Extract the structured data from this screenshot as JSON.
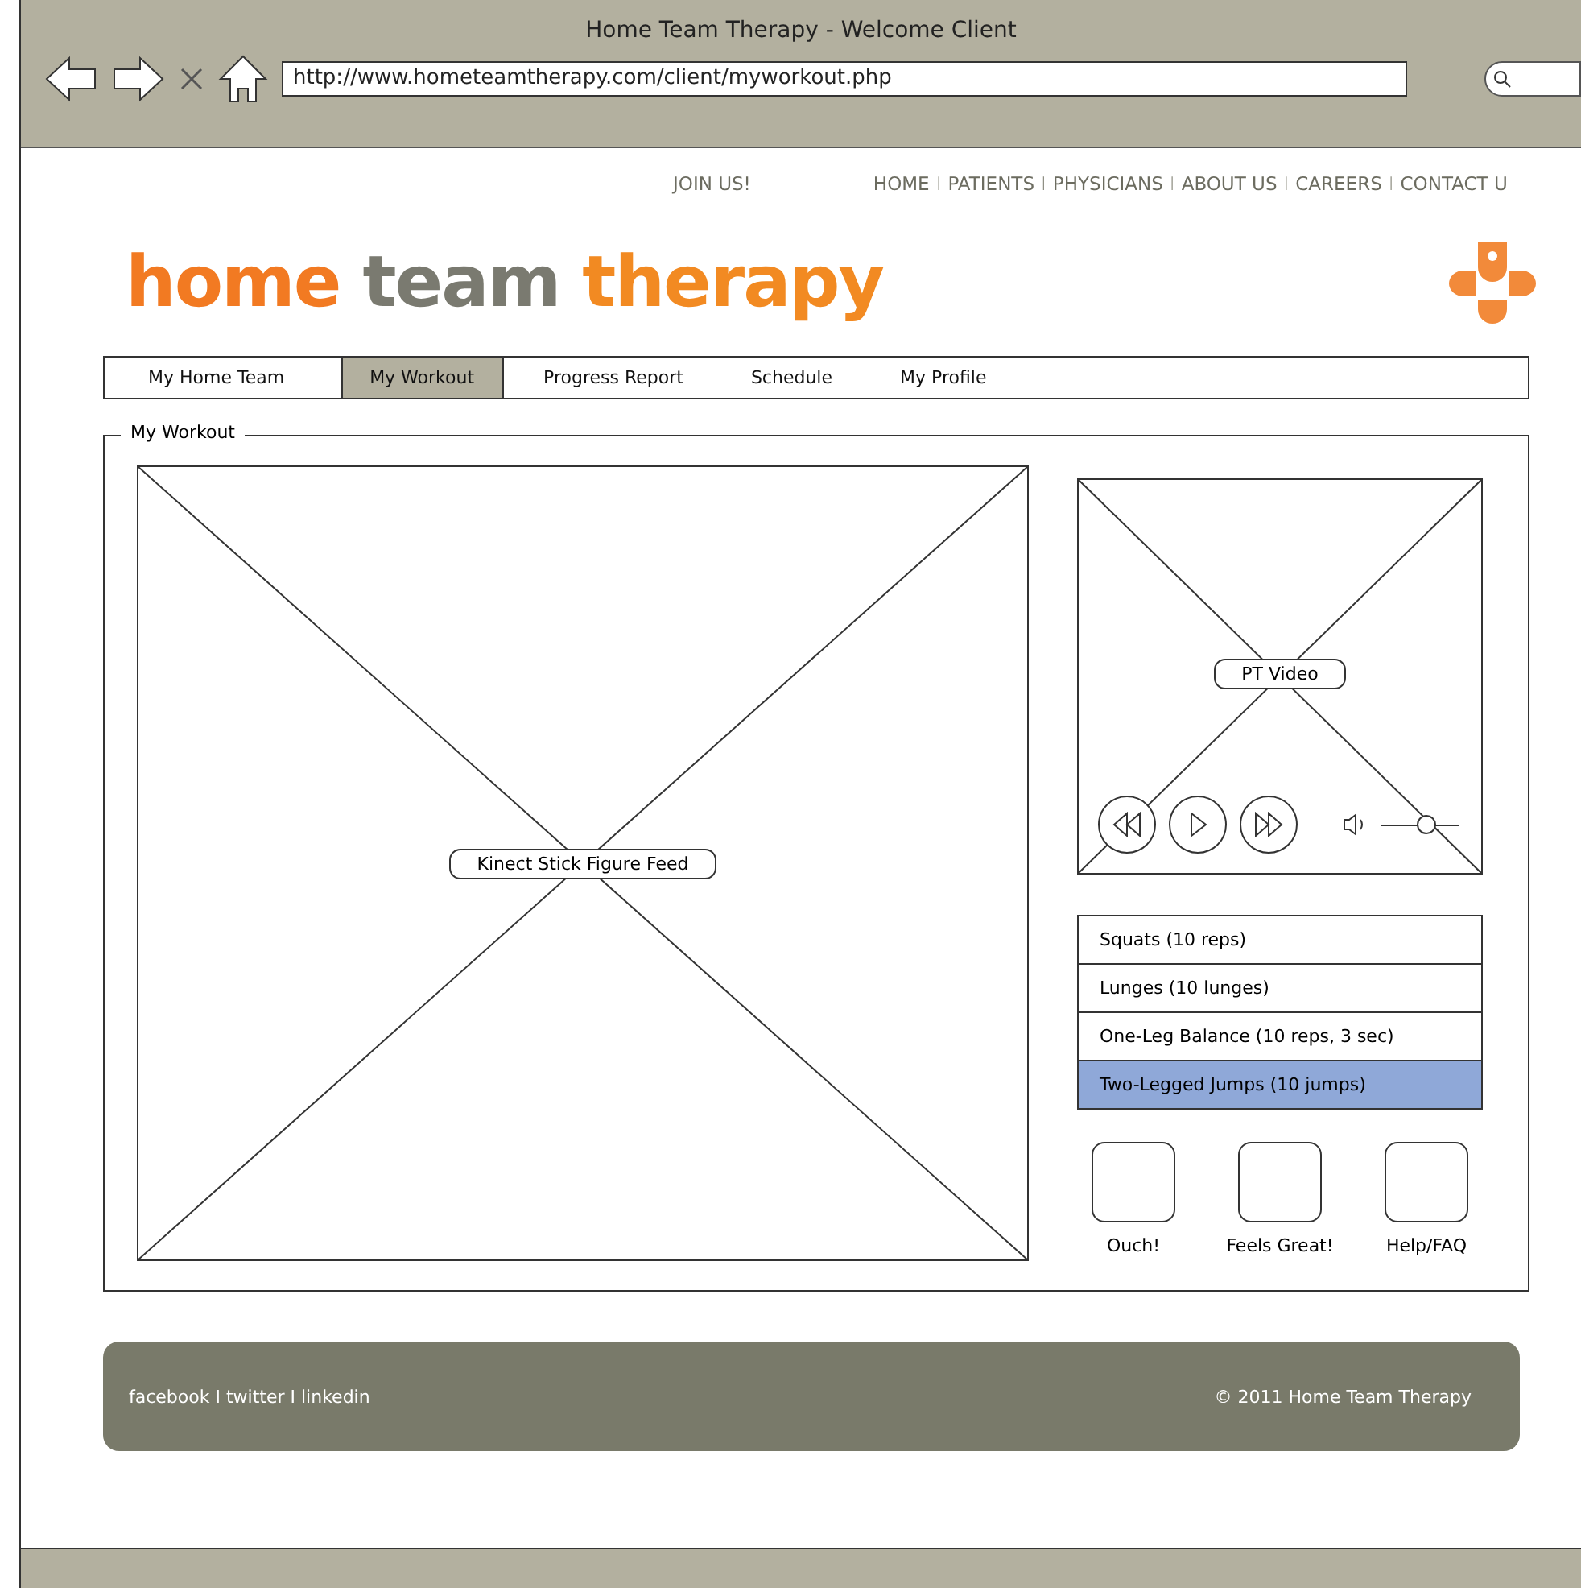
{
  "window": {
    "title": "Home Team Therapy - Welcome Client",
    "url": "http://www.hometeamtherapy.com/client/myworkout.php"
  },
  "top_links": {
    "join": "JOIN US!",
    "items": [
      {
        "kind": "link",
        "text": "HOME"
      },
      {
        "kind": "separator",
        "text": "I"
      },
      {
        "kind": "link",
        "text": "PATIENTS"
      },
      {
        "kind": "separator",
        "text": "I"
      },
      {
        "kind": "link",
        "text": "PHYSICIANS"
      },
      {
        "kind": "separator",
        "text": "I"
      },
      {
        "kind": "link",
        "text": "ABOUT US"
      },
      {
        "kind": "separator",
        "text": "I"
      },
      {
        "kind": "link",
        "text": "CAREERS"
      },
      {
        "kind": "separator",
        "text": "I"
      },
      {
        "kind": "link",
        "text": "CONTACT U"
      }
    ]
  },
  "logo": [
    {
      "text": "home",
      "color": "#f27a22"
    },
    {
      "text": "team",
      "color": "#7a7a70"
    },
    {
      "text": "therapy",
      "color": "#f28a22"
    }
  ],
  "tabs": [
    {
      "label": "My Home Team",
      "selected": false
    },
    {
      "label": "My Workout",
      "selected": true
    },
    {
      "label": "Progress Report",
      "selected": false
    },
    {
      "label": "Schedule",
      "selected": false
    },
    {
      "label": "My Profile",
      "selected": false
    }
  ],
  "section": {
    "title": "My Workout",
    "feed_label": "Kinect Stick Figure Feed",
    "video": {
      "label": "PT Video",
      "volume": {
        "level": 0.58
      }
    },
    "exercises": [
      {
        "label": "Squats (10 reps)",
        "selected": false
      },
      {
        "label": "Lunges (10 lunges)",
        "selected": false
      },
      {
        "label": "One-Leg Balance (10 reps, 3 sec)",
        "selected": false
      },
      {
        "label": "Two-Legged Jumps (10 jumps)",
        "selected": true
      }
    ],
    "feedback_buttons": [
      "Ouch!",
      "Feels Great!",
      "Help/FAQ"
    ]
  },
  "footer": {
    "social": "facebook I twitter I linkedin",
    "copyright": "© 2011 Home Team Therapy"
  }
}
